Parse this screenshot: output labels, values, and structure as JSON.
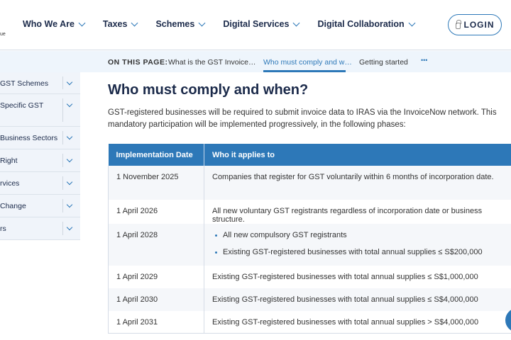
{
  "header": {
    "logo_fragment": "ue",
    "nav": [
      "Who We Are",
      "Taxes",
      "Schemes",
      "Digital Services",
      "Digital Collaboration"
    ],
    "login": "LOGIN"
  },
  "on_this_page": {
    "label": "ON THIS PAGE:",
    "links": [
      "What is the GST Invoice…",
      "Who must comply and w…",
      "Getting started"
    ],
    "more": "•••",
    "active_index": 1
  },
  "sidebar": {
    "items": [
      "GST Schemes",
      "Specific GST",
      "Business Sectors",
      "Right",
      "rvices",
      "Change",
      "rs"
    ]
  },
  "main": {
    "title": "Who must comply and when?",
    "intro": "GST-registered businesses will be required to submit invoice data to IRAS via the InvoiceNow network. This mandatory participation will be implemented progressively, in the following phases:",
    "table": {
      "headers": [
        "Implementation Date",
        "Who it applies to"
      ],
      "rows": [
        {
          "date": "1 November 2025",
          "text": "Companies that register for GST voluntarily within 6 months of incorporation date."
        },
        {
          "date": "1 April 2026",
          "text": "All new voluntary GST registrants regardless of incorporation date or business structure."
        },
        {
          "date": "1 April 2028",
          "bullets": [
            "All new compulsory GST registrants",
            "Existing GST-registered businesses with total annual supplies ≤ S$200,000"
          ]
        },
        {
          "date": "1 April 2029",
          "text": "Existing GST-registered businesses with total annual supplies ≤ S$1,000,000"
        },
        {
          "date": "1 April 2030",
          "text": "Existing GST-registered businesses with total annual supplies ≤ S$4,000,000"
        },
        {
          "date": "1 April 2031",
          "text": "Existing GST-registered businesses with total annual supplies > S$4,000,000"
        }
      ]
    }
  },
  "colors": {
    "accent": "#2d78b8",
    "heading": "#1b2a4a",
    "subnav_bg": "#eef5fc",
    "sidebar_bg": "#f0f4fa"
  }
}
